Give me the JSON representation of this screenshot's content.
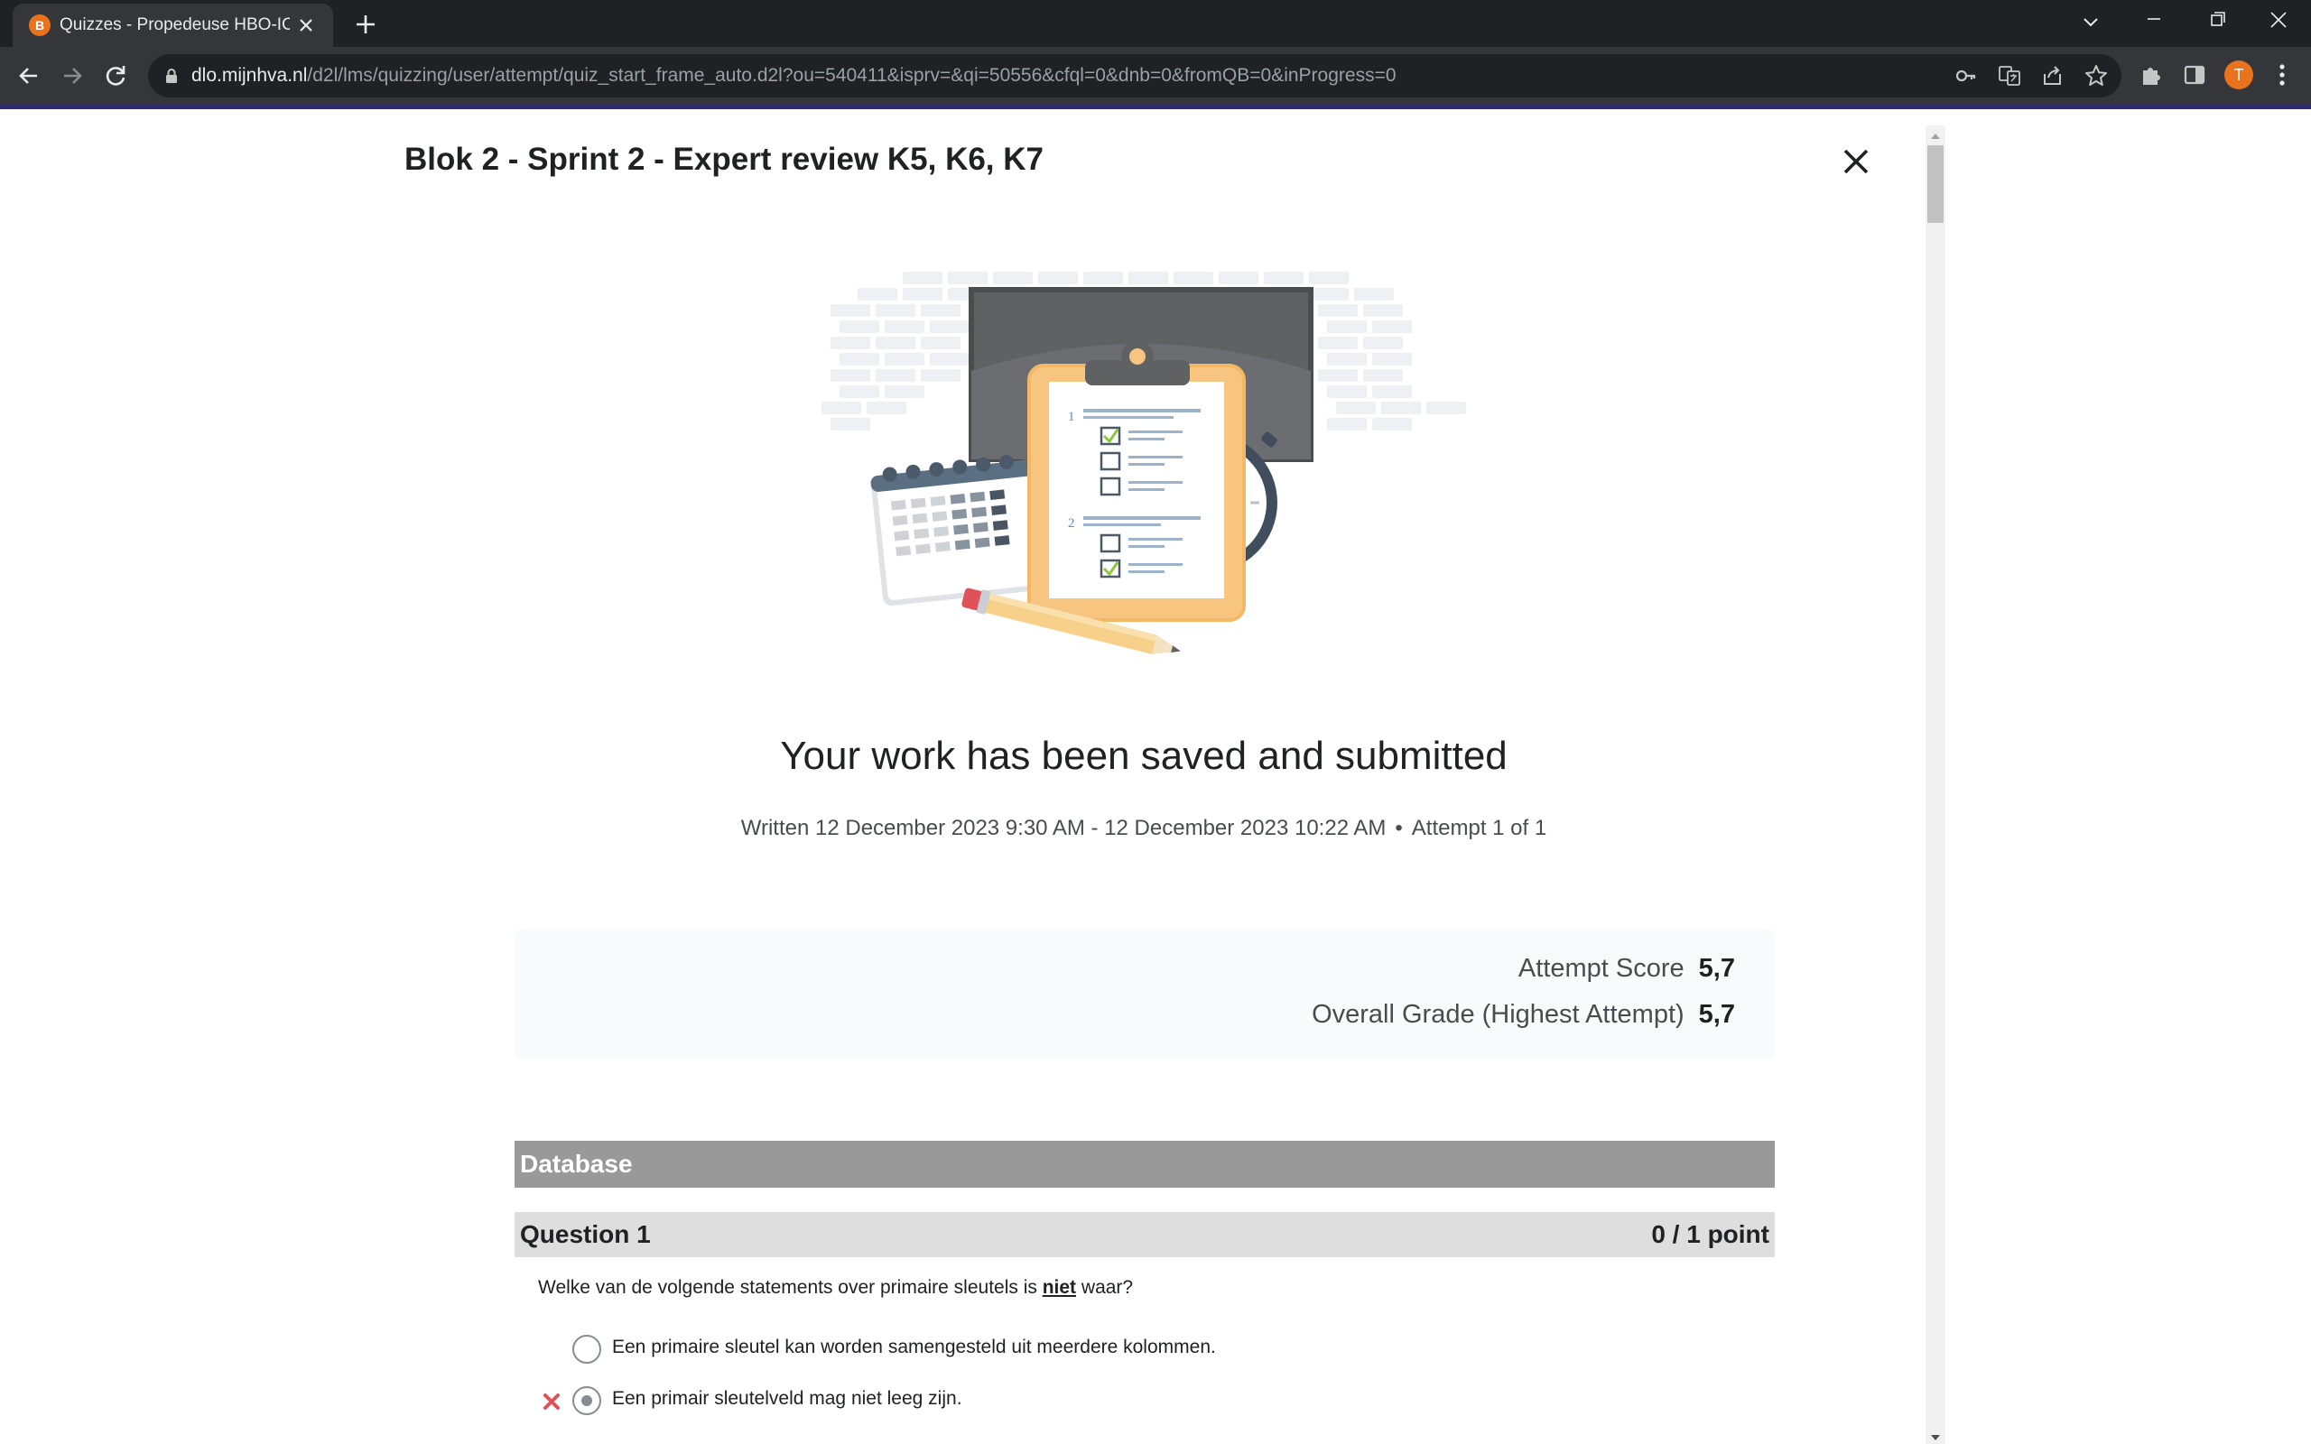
{
  "browser": {
    "tab_title": "Quizzes - Propedeuse HBO-ICT ...",
    "favicon_letter": "B",
    "url_host": "dlo.mijnhva.nl",
    "url_path": "/d2l/lms/quizzing/user/attempt/quiz_start_frame_auto.d2l?ou=540411&isprv=&qi=50556&cfql=0&dnb=0&fromQB=0&inProgress=0",
    "profile_initial": "T",
    "accent_color": "#2e2a6b"
  },
  "quiz": {
    "title": "Blok 2 - Sprint 2 - Expert review K5, K6, K7",
    "headline": "Your work has been saved and submitted",
    "written": "Written 12 December 2023 9:30 AM - 12 December 2023 10:22 AM",
    "bullet": "•",
    "attempt": "Attempt 1 of 1",
    "scores": [
      {
        "label": "Attempt Score",
        "value": "5,7"
      },
      {
        "label": "Overall Grade (Highest Attempt)",
        "value": "5,7"
      }
    ]
  },
  "section": {
    "title": "Database"
  },
  "question": {
    "title": "Question 1",
    "points": "0 / 1 point",
    "text_before": "Welke van de volgende statements over primaire sleutels is ",
    "text_emph": "niet",
    "text_after": " waar?",
    "options": [
      {
        "label": "Een primaire sleutel kan worden samengesteld uit meerdere kolommen.",
        "selected": false,
        "wrong": false
      },
      {
        "label": "Een primair sleutelveld mag niet leeg zijn.",
        "selected": true,
        "wrong": true
      }
    ]
  },
  "illustration": {
    "checklist_numbers": [
      "1",
      "2"
    ]
  },
  "colors": {
    "wrong_mark": "#e0525a",
    "section_bar": "#999999",
    "question_bar": "#dedede",
    "clipboard": "#f7c57f"
  }
}
